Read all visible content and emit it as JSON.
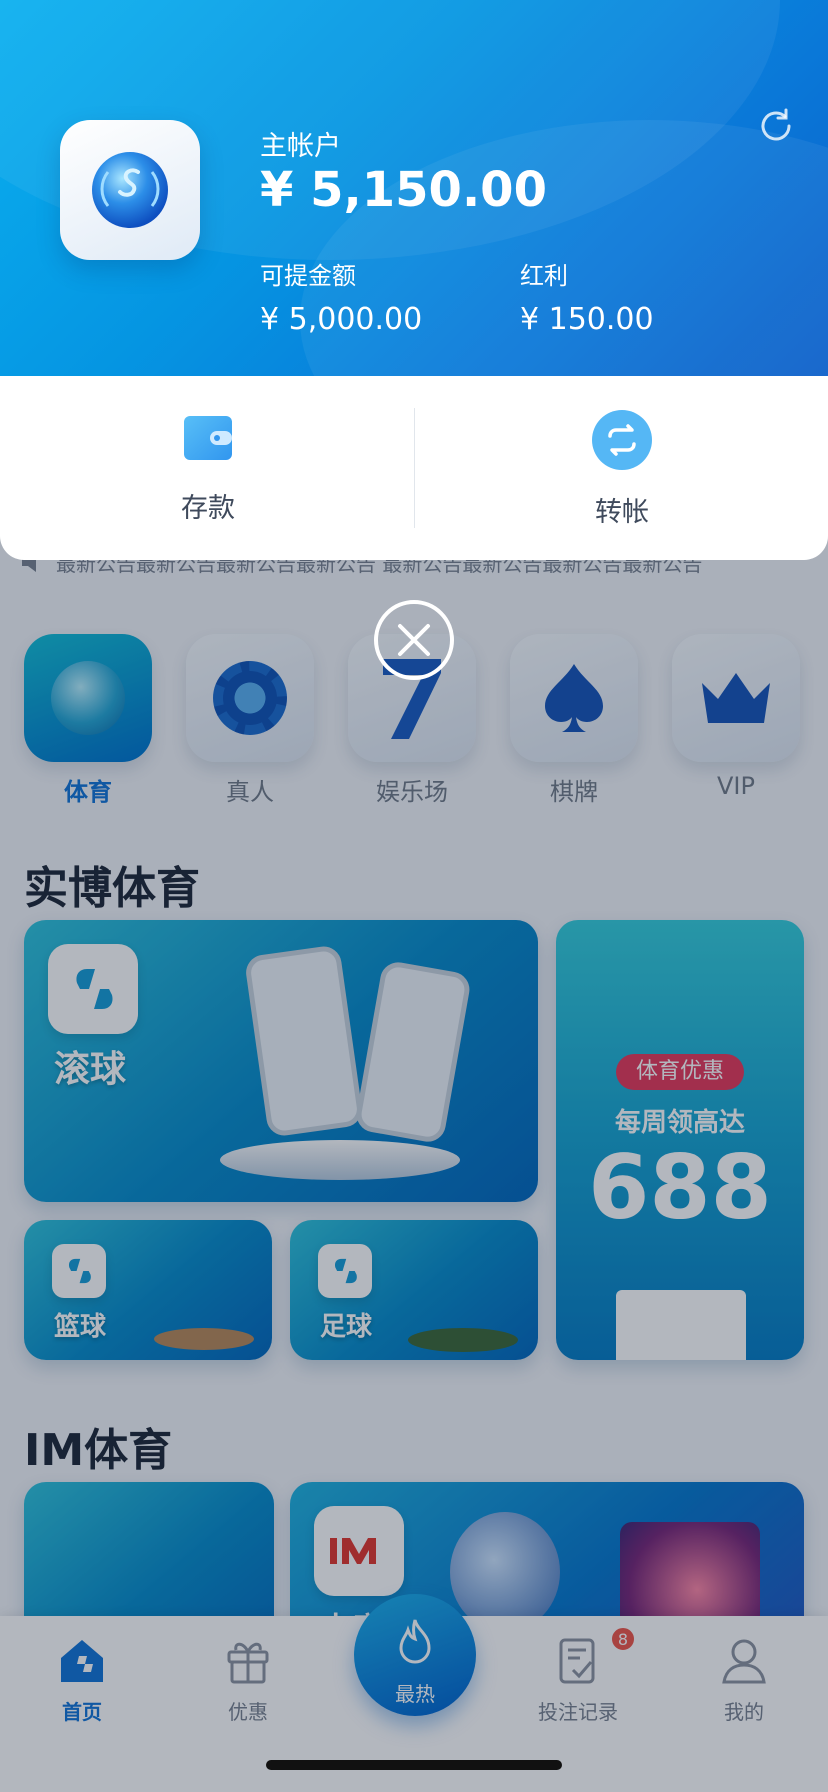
{
  "account": {
    "title": "主帐户",
    "balance": "¥ 5,150.00",
    "withdrawable_label": "可提金额",
    "withdrawable_value": "¥ 5,000.00",
    "bonus_label": "红利",
    "bonus_value": "¥ 150.00"
  },
  "actions": {
    "deposit": "存款",
    "transfer": "转帐"
  },
  "marquee": "最新公告最新公告最新公告最新公告    最新公告最新公告最新公告最新公告",
  "categories": [
    "体育",
    "真人",
    "娱乐场",
    "棋牌",
    "VIP"
  ],
  "sections": {
    "sbo_title": "实博体育",
    "im_title": "IM体育"
  },
  "cards": {
    "live_label": "滚球",
    "basketball_label": "篮球",
    "football_label": "足球",
    "promo_badge": "体育优惠",
    "promo_line": "每周领高达",
    "promo_amount": "688",
    "im_label": "电竞"
  },
  "nav": {
    "home": "首页",
    "promo": "优惠",
    "hot": "最热",
    "records": "投注记录",
    "records_badge": "8",
    "mine": "我的"
  },
  "colors": {
    "accent": "#1677d9",
    "hero_start": "#0ab0ef",
    "hero_end": "#0c5fc9",
    "badge": "#f05a4d"
  },
  "icons": {
    "refresh": "refresh-icon",
    "deposit": "wallet-icon",
    "transfer": "transfer-icon",
    "close": "close-icon",
    "speaker": "speaker-icon"
  }
}
